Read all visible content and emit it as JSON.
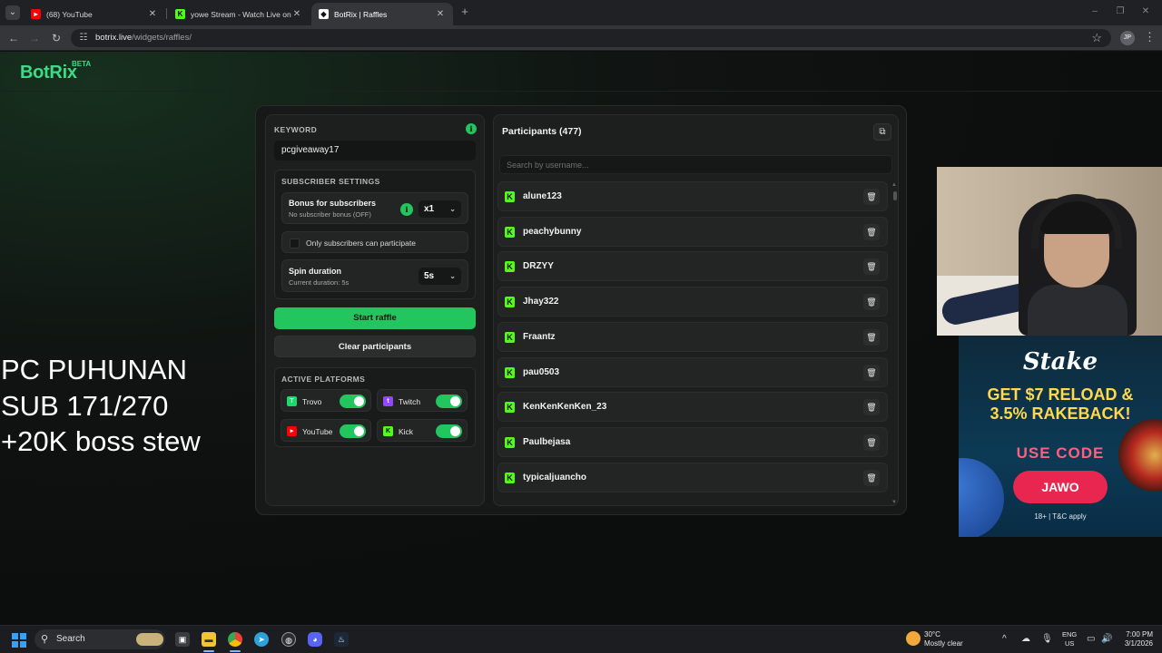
{
  "browser": {
    "tabs": [
      {
        "title": "(68) YouTube",
        "favicon": "youtube-icon",
        "color": "#ff0000"
      },
      {
        "title": "yowe Stream - Watch Live on Kick",
        "favicon": "kick-icon",
        "color": "#53fc18"
      },
      {
        "title": "BotRix | Raffles",
        "favicon": "botrix-icon",
        "color": "#ffffff"
      }
    ],
    "url_host": "botrix.live",
    "url_path": "/widgets/raffles/",
    "profile_initials": "JP"
  },
  "site": {
    "logo": "BotRix",
    "logo_badge": "BETA"
  },
  "overlay": {
    "line1": "PC PUHUNAN",
    "line2": "SUB 171/270",
    "line3": "+20K boss stew"
  },
  "raffle": {
    "keyword_label": "KEYWORD",
    "keyword_value": "pcgiveaway17",
    "subscriber_settings_label": "SUBSCRIBER SETTINGS",
    "bonus_title": "Bonus for subscribers",
    "bonus_sub": "No subscriber bonus (OFF)",
    "bonus_value": "x1",
    "only_subs_label": "Only subscribers can participate",
    "only_subs_checked": false,
    "spin_title": "Spin duration",
    "spin_sub": "Current duration: 5s",
    "spin_value": "5s",
    "start_label": "Start raffle",
    "clear_label": "Clear participants",
    "platforms_label": "ACTIVE PLATFORMS",
    "platforms": [
      {
        "name": "Trovo",
        "icon": "trovo-icon",
        "color": "#1bd96a",
        "enabled": true
      },
      {
        "name": "Twitch",
        "icon": "twitch-icon",
        "color": "#9146ff",
        "enabled": true
      },
      {
        "name": "YouTube",
        "icon": "youtube-icon",
        "color": "#ff0000",
        "enabled": true
      },
      {
        "name": "Kick",
        "icon": "kick-icon",
        "color": "#53fc18",
        "enabled": true
      }
    ],
    "accent_color": "#22c55e"
  },
  "participants": {
    "title": "Participants (477)",
    "search_placeholder": "Search by username...",
    "list": [
      "alune123",
      "peachybunny",
      "DRZYY",
      "Jhay322",
      "Fraantz",
      "pau0503",
      "KenKenKenKen_23",
      "Paulbejasa",
      "typicaljuancho"
    ]
  },
  "ad": {
    "brand": "Stake",
    "headline1": "GET $7 RELOAD &",
    "headline2": "3.5% RAKEBACK!",
    "use_code": "USE CODE",
    "code": "JAWO",
    "terms": "18+ | T&C apply"
  },
  "taskbar": {
    "search_label": "Search",
    "weather_temp": "30°C",
    "weather_cond": "Mostly clear",
    "lang1": "ENG",
    "lang2": "US",
    "time": "7:00 PM",
    "date": "3/1/2026"
  }
}
